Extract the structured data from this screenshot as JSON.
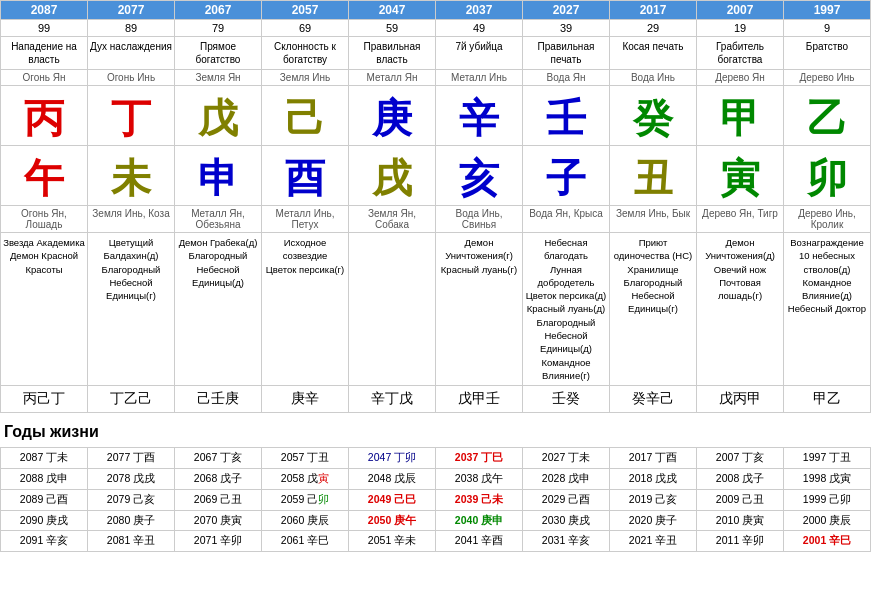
{
  "years": [
    "2087",
    "2077",
    "2067",
    "2057",
    "2047",
    "2037",
    "2027",
    "2017",
    "2007",
    "1997"
  ],
  "nums": [
    "99",
    "89",
    "79",
    "69",
    "59",
    "49",
    "39",
    "29",
    "19",
    "9"
  ],
  "titles": [
    "Нападение на власть",
    "Дух наслаждения",
    "Прямое богатство",
    "Склонность к богатству",
    "Правильная власть",
    "7й убийца",
    "Правильная печать",
    "Косая печать",
    "Грабитель богатства",
    "Братство"
  ],
  "elem1": [
    "Огонь Ян",
    "Огонь Инь",
    "Земля Ян",
    "Земля Инь",
    "Металл Ян",
    "Металл Инь",
    "Вода Ян",
    "Вода Инь",
    "Дерево Ян",
    "Дерево Инь"
  ],
  "topChars": [
    {
      "char": "丙",
      "color": "red"
    },
    {
      "char": "丁",
      "color": "red"
    },
    {
      "char": "戊",
      "color": "olive"
    },
    {
      "char": "己",
      "color": "olive"
    },
    {
      "char": "庚",
      "color": "blue"
    },
    {
      "char": "辛",
      "color": "blue"
    },
    {
      "char": "壬",
      "color": "blue"
    },
    {
      "char": "癸",
      "color": "green"
    },
    {
      "char": "甲",
      "color": "green"
    },
    {
      "char": "乙",
      "color": "green"
    }
  ],
  "botChars": [
    {
      "char": "午",
      "color": "red"
    },
    {
      "char": "未",
      "color": "olive"
    },
    {
      "char": "申",
      "color": "blue"
    },
    {
      "char": "酉",
      "color": "blue"
    },
    {
      "char": "戌",
      "color": "olive"
    },
    {
      "char": "亥",
      "color": "blue"
    },
    {
      "char": "子",
      "color": "blue"
    },
    {
      "char": "丑",
      "color": "olive"
    },
    {
      "char": "寅",
      "color": "green"
    },
    {
      "char": "卯",
      "color": "green"
    }
  ],
  "elem2": [
    "Огонь Ян, Лошадь",
    "Земля Инь, Коза",
    "Металл Ян, Обезьяна",
    "Металл Инь, Петух",
    "Земля Ян, Собака",
    "Вода Инь, Свинья",
    "Вода Ян, Крыса",
    "Земля Инь, Бык",
    "Дерево Ян, Тигр",
    "Дерево Инь, Кролик"
  ],
  "desc": [
    "Звезда Академика\nДемон Красной Красоты",
    "Цветущий Балдахин(д)\nБлагородный Небесной Единицы(г)",
    "Демон Грабека(д)\nБлагородный Небесной Единицы(д)",
    "Исходное созвездие\nЦветок персика(г)",
    "",
    "Демон Уничтожения(г)\nКрасный луань(г)",
    "Небесная благодать\nЛунная добродетель\nЦветок персика(д)\nКрасный луань(д)\nБлагородный Небесной Единицы(д)\nКомандное Влияние(г)",
    "Приют одиночества (НС)\nХранилище\nБлагородный Небесной Единицы(г)",
    "Демон Уничтожения(д)\nОвечий нож\nПочтовая лошадь(г)",
    "Вознаграждение 10 небесных стволов(д)\nКомандное Влияние(д)\nНебесный Доктор"
  ],
  "smallChars": [
    "丙己丁",
    "丁乙己",
    "己壬庚",
    "庚辛",
    "辛丁戊",
    "戊甲壬",
    "壬癸",
    "癸辛己",
    "戊丙甲",
    "甲乙"
  ],
  "lifeTitle": "Годы жизни",
  "lifeRows": [
    [
      "2087 丁未",
      "2077 丁酉",
      "2067 丁亥",
      "2057 丁丑",
      "2047 丁卯",
      "2037 丁巳",
      "2027 丁未",
      "2017 丁酉",
      "2007 丁亥",
      "1997 丁丑"
    ],
    [
      "2088 戊申",
      "2078 戊戌",
      "2068 戊子",
      "2058 戊寅",
      "2048 戊辰",
      "2038 戊午",
      "2028 戊申",
      "2018 戊戌",
      "2008 戊子",
      "1998 戊寅"
    ],
    [
      "2089 己酉",
      "2079 己亥",
      "2069 己丑",
      "2059 己卯",
      "2049 己巳",
      "2039 己未",
      "2029 己酉",
      "2019 己亥",
      "2009 己丑",
      "1999 己卯"
    ],
    [
      "2090 庚戌",
      "2080 庚子",
      "2070 庚寅",
      "2060 庚辰",
      "2050 庚午",
      "2040 庚申",
      "2030 庚戌",
      "2020 庚子",
      "2010 庚寅",
      "2000 庚辰"
    ],
    [
      "2091 辛亥",
      "2081 辛丑",
      "2071 辛卯",
      "2061 辛巳",
      "2051 辛未",
      "2041 辛酉",
      "2031 辛亥",
      "2021 辛丑",
      "2011 辛卯",
      "2001 辛巳"
    ]
  ],
  "lifeHighlights": {
    "2047 丁卯": "blue",
    "2037 丁巳": "red",
    "2049 己巳": "red",
    "2039 己未": "red",
    "2050 庚午": "red",
    "2040 庚申": "green",
    "2001 辛巳": "red"
  }
}
